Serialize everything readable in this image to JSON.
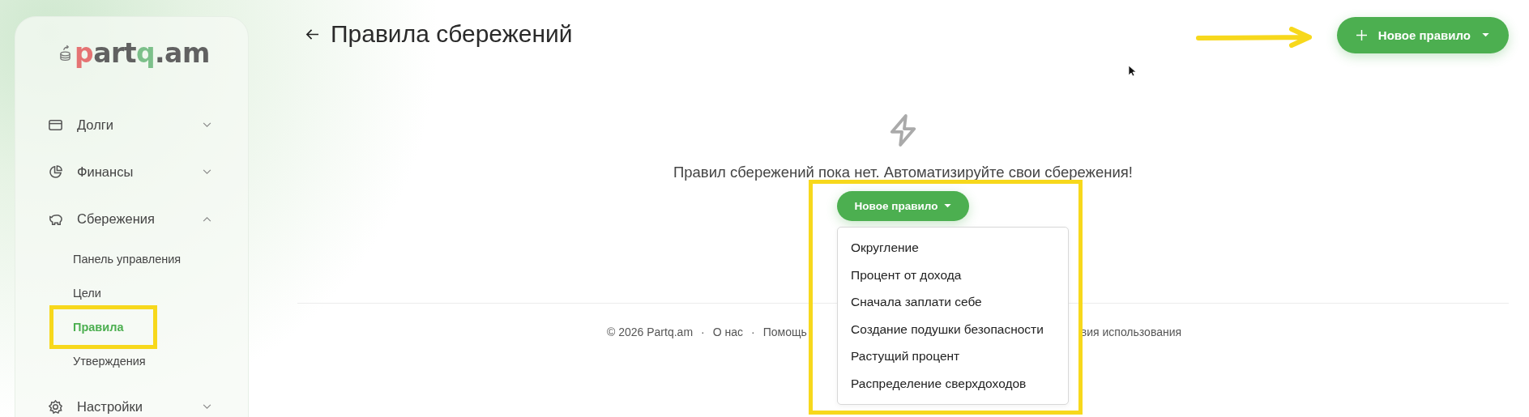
{
  "logo": [
    {
      "text": "p",
      "color": "#e57373"
    },
    {
      "text": "art",
      "color": "#616161"
    },
    {
      "text": "q",
      "color": "#7cc08a"
    },
    {
      "text": ".am",
      "color": "#616161"
    }
  ],
  "sidebar": {
    "items": [
      {
        "label": "Долги",
        "kind": "group",
        "expanded": false
      },
      {
        "label": "Финансы",
        "kind": "group",
        "expanded": false
      },
      {
        "label": "Сбережения",
        "kind": "group",
        "expanded": true,
        "children": [
          {
            "label": "Панель управления",
            "selected": false
          },
          {
            "label": "Цели",
            "selected": false
          },
          {
            "label": "Правила",
            "selected": true
          },
          {
            "label": "Утверждения",
            "selected": false
          }
        ]
      },
      {
        "label": "Настройки",
        "kind": "group",
        "expanded": false
      }
    ]
  },
  "header": {
    "title": "Правила сбережений",
    "button": {
      "label": "Новое правило"
    }
  },
  "empty_state": {
    "message": "Правил сбережений пока нет. Автоматизируйте свои сбережения!",
    "button": {
      "label": "Новое правило"
    },
    "menu": [
      "Округление",
      "Процент от дохода",
      "Сначала заплати себе",
      "Создание подушки безопасности",
      "Растущий процент",
      "Распределение сверхдоходов"
    ]
  },
  "footer": {
    "left": [
      "© 2026 Partq.am",
      "·",
      "О нас",
      "·",
      "Помощь"
    ],
    "right": "вия использования"
  }
}
